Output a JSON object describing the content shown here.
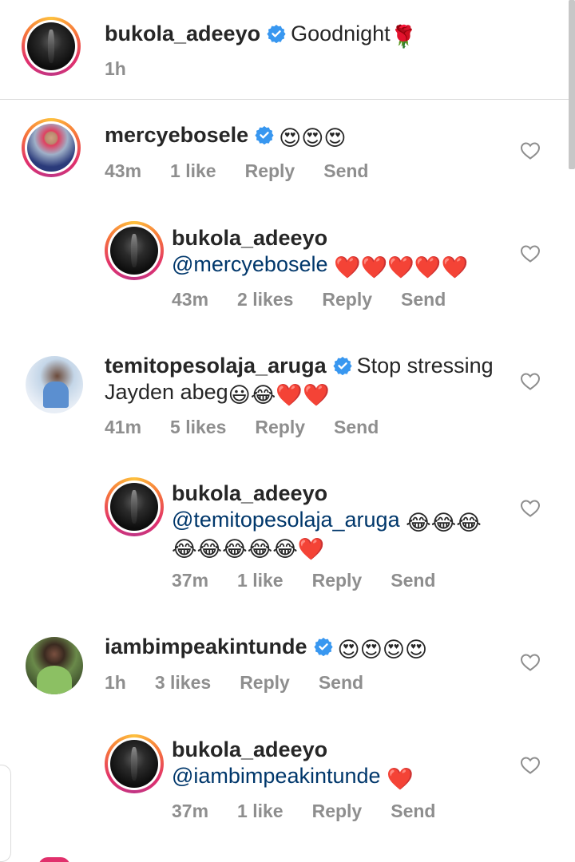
{
  "caption": {
    "username": "bukola_adeeyo",
    "text": "Goodnight",
    "emoji": "🌹",
    "time": "1h"
  },
  "comments": [
    {
      "username": "mercyebosele",
      "text": "",
      "emoji": "😍😍😍",
      "time": "43m",
      "likes": "1 like",
      "reply": "Reply",
      "send": "Send"
    },
    {
      "username": "bukola_adeeyo",
      "mention": "@mercyebosele",
      "emoji": "❤️❤️❤️❤️❤️",
      "time": "43m",
      "likes": "2 likes",
      "reply": "Reply",
      "send": "Send"
    },
    {
      "username": "temitopesolaja_aruga",
      "text": "Stop stressing",
      "text2": "Jayden abeg",
      "emoji": "😃😂❤️❤️",
      "time": "41m",
      "likes": "5 likes",
      "reply": "Reply",
      "send": "Send"
    },
    {
      "username": "bukola_adeeyo",
      "mention": "@temitopesolaja_aruga",
      "emoji": "😂😂😂",
      "emoji2": "😂😂😂😂😂❤️",
      "time": "37m",
      "likes": "1 like",
      "reply": "Reply",
      "send": "Send"
    },
    {
      "username": "iambimpeakintunde",
      "text": "",
      "emoji": "😍😍😍😍",
      "time": "1h",
      "likes": "3 likes",
      "reply": "Reply",
      "send": "Send"
    },
    {
      "username": "bukola_adeeyo",
      "mention": "@iambimpeakintunde",
      "emoji": "❤️",
      "time": "37m",
      "likes": "1 like",
      "reply": "Reply",
      "send": "Send"
    }
  ],
  "colors": {
    "verified": "#3897f0",
    "mention": "#00376b",
    "muted": "#8e8e8e"
  }
}
